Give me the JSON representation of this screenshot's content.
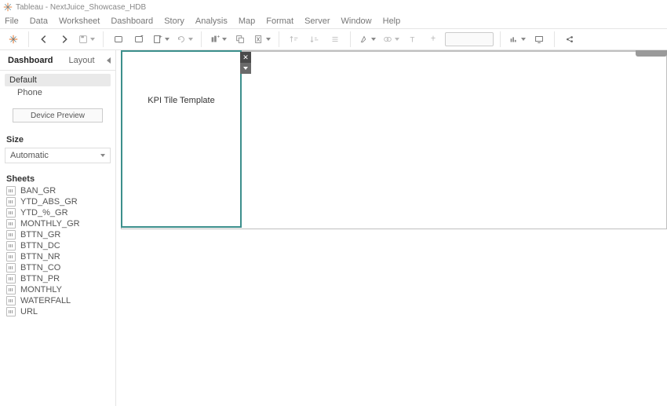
{
  "app": {
    "title": "Tableau - NextJuice_Showcase_HDB"
  },
  "menu": [
    "File",
    "Data",
    "Worksheet",
    "Dashboard",
    "Story",
    "Analysis",
    "Map",
    "Format",
    "Server",
    "Window",
    "Help"
  ],
  "side": {
    "tabs": {
      "dashboard": "Dashboard",
      "layout": "Layout"
    },
    "devices": {
      "default": "Default",
      "phone": "Phone",
      "preview_btn": "Device Preview"
    },
    "size": {
      "label": "Size",
      "value": "Automatic"
    },
    "sheets_label": "Sheets",
    "sheets": [
      "BAN_GR",
      "YTD_ABS_GR",
      "YTD_%_GR",
      "MONTHLY_GR",
      "BTTN_GR",
      "BTTN_DC",
      "BTTN_NR",
      "BTTN_CO",
      "BTTN_PR",
      "MONTHLY",
      "WATERFALL",
      "URL"
    ]
  },
  "canvas": {
    "tile_label": "KPI Tile Template"
  }
}
